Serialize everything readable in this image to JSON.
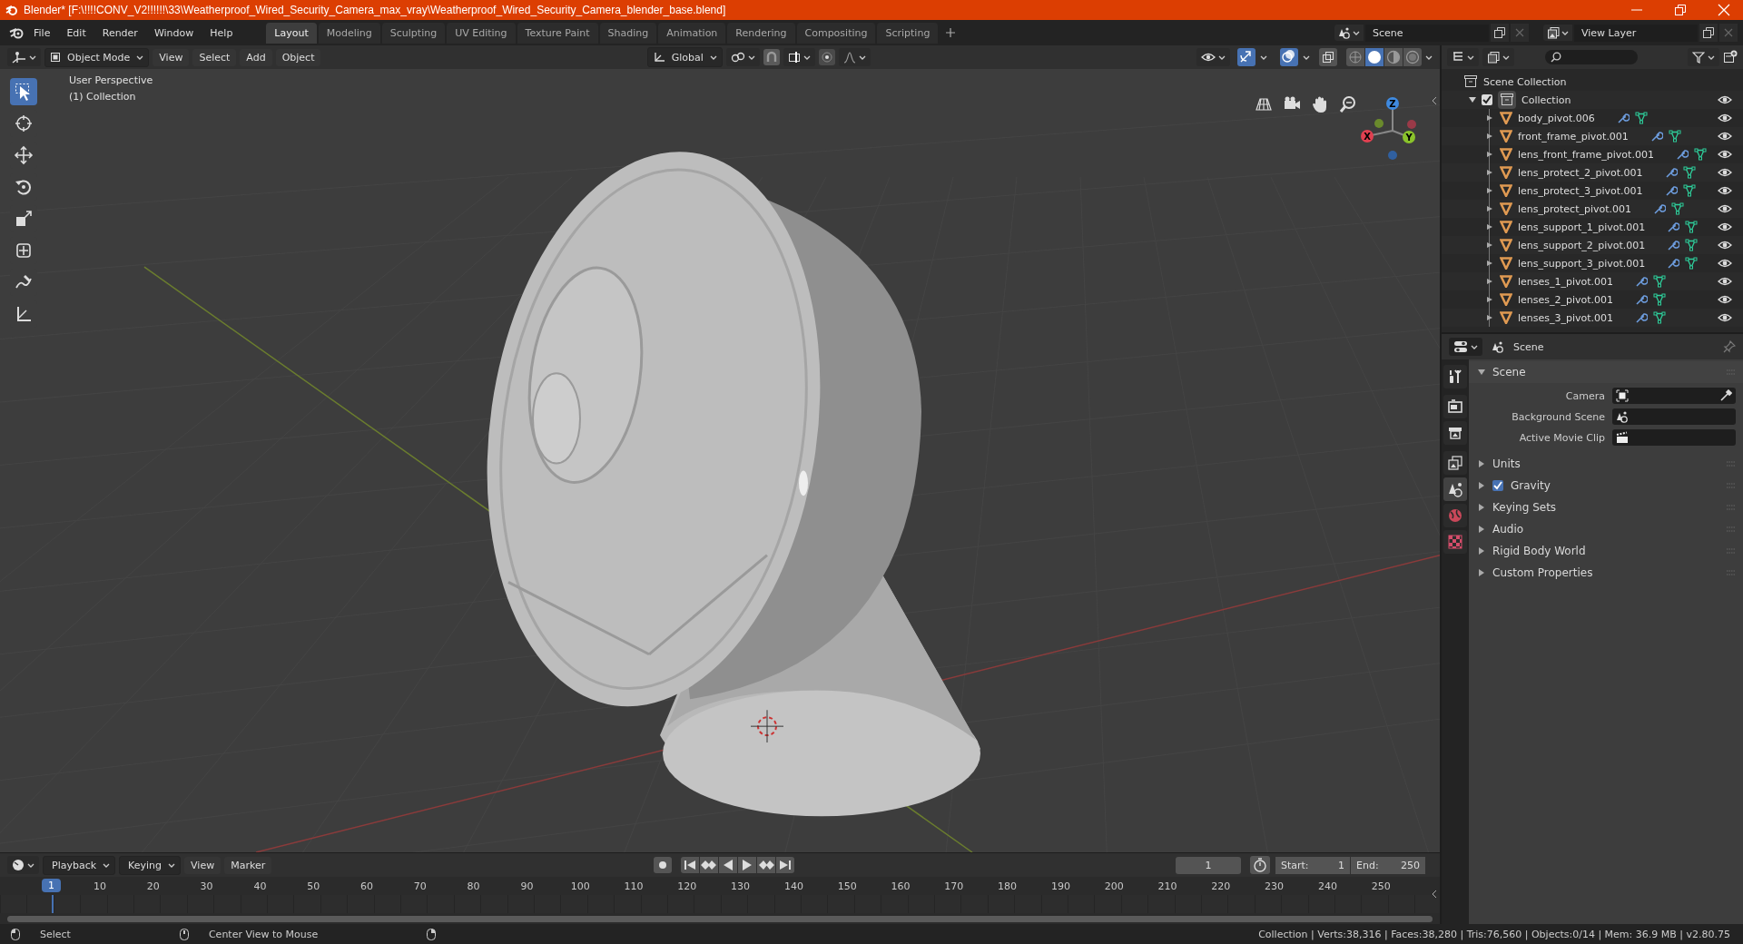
{
  "window": {
    "title": "Blender* [F:\\!!!!CONV_V2!!!!!!\\33\\Weatherproof_Wired_Security_Camera_max_vray\\Weatherproof_Wired_Security_Camera_blender_base.blend]"
  },
  "menu": [
    "File",
    "Edit",
    "Render",
    "Window",
    "Help"
  ],
  "workspaces": [
    {
      "label": "Layout",
      "selected": true
    },
    {
      "label": "Modeling",
      "selected": false
    },
    {
      "label": "Sculpting",
      "selected": false
    },
    {
      "label": "UV Editing",
      "selected": false
    },
    {
      "label": "Texture Paint",
      "selected": false
    },
    {
      "label": "Shading",
      "selected": false
    },
    {
      "label": "Animation",
      "selected": false
    },
    {
      "label": "Rendering",
      "selected": false
    },
    {
      "label": "Compositing",
      "selected": false
    },
    {
      "label": "Scripting",
      "selected": false
    }
  ],
  "scene": "Scene",
  "view_layer": "View Layer",
  "viewport": {
    "mode": "Object Mode",
    "menus": [
      "View",
      "Select",
      "Add",
      "Object"
    ],
    "orientation": "Global",
    "view_name": "User Perspective",
    "collection": "(1) Collection",
    "toggles": [
      {
        "kind": "gizmo",
        "on": true
      },
      {
        "kind": "overlay",
        "on": true
      }
    ],
    "shading": [
      {
        "kind": "wireframe",
        "selected": false
      },
      {
        "kind": "solid",
        "selected": true
      },
      {
        "kind": "material",
        "selected": false
      },
      {
        "kind": "rendered",
        "selected": false
      }
    ],
    "tools": [
      {
        "kind": "select",
        "selected": true
      },
      {
        "kind": "cursor",
        "selected": false
      },
      {
        "kind": "move",
        "selected": false
      },
      {
        "kind": "rotate",
        "selected": false
      },
      {
        "kind": "scale",
        "selected": false
      },
      {
        "kind": "transform",
        "selected": false
      },
      {
        "kind": "annotate",
        "selected": false
      },
      {
        "kind": "measure",
        "selected": false
      }
    ],
    "axes": [
      "X",
      "Y",
      "Z"
    ]
  },
  "outliner": {
    "root": "Scene Collection",
    "collections": [
      {
        "name": "Collection",
        "expanded": true,
        "checked": true,
        "children": [
          {
            "name": "body_pivot.006"
          },
          {
            "name": "front_frame_pivot.001"
          },
          {
            "name": "lens_front_frame_pivot.001"
          },
          {
            "name": "lens_protect_2_pivot.001"
          },
          {
            "name": "lens_protect_3_pivot.001"
          },
          {
            "name": "lens_protect_pivot.001"
          },
          {
            "name": "lens_support_1_pivot.001"
          },
          {
            "name": "lens_support_2_pivot.001"
          },
          {
            "name": "lens_support_3_pivot.001"
          },
          {
            "name": "lenses_1_pivot.001"
          },
          {
            "name": "lenses_2_pivot.001"
          },
          {
            "name": "lenses_3_pivot.001"
          }
        ]
      }
    ]
  },
  "properties": {
    "context": "Scene",
    "tabs": [
      {
        "kind": "tool",
        "selected": false
      },
      {
        "kind": "render",
        "selected": false
      },
      {
        "kind": "output",
        "selected": false
      },
      {
        "kind": "viewlayer",
        "selected": false
      },
      {
        "kind": "scene",
        "selected": true
      },
      {
        "kind": "world",
        "selected": false
      },
      {
        "kind": "texture",
        "selected": false
      }
    ],
    "panels": [
      {
        "kind": "panel",
        "label": "Scene",
        "expanded": true,
        "fields": [
          {
            "kind": "camera",
            "label": "Camera"
          },
          {
            "kind": "scene",
            "label": "Background Scene"
          },
          {
            "kind": "clip",
            "label": "Active Movie Clip"
          }
        ]
      },
      {
        "kind": "panel",
        "label": "Units",
        "expanded": false
      },
      {
        "kind": "toggle",
        "label": "Gravity",
        "expanded": false,
        "checked": true
      },
      {
        "kind": "panel",
        "label": "Keying Sets",
        "expanded": false
      },
      {
        "kind": "panel",
        "label": "Audio",
        "expanded": false
      },
      {
        "kind": "panel",
        "label": "Rigid Body World",
        "expanded": false
      },
      {
        "kind": "panel",
        "label": "Custom Properties",
        "expanded": false
      }
    ]
  },
  "timeline": {
    "menus": [
      {
        "label": "Playback",
        "dropdown": true
      },
      {
        "label": "Keying",
        "dropdown": true
      },
      {
        "label": "View",
        "dropdown": false
      },
      {
        "label": "Marker",
        "dropdown": false
      }
    ],
    "current_frame": "1",
    "start_label": "Start:",
    "start": "1",
    "end_label": "End:",
    "end": "250",
    "frame_marker": "1",
    "ruler": [
      "10",
      "20",
      "30",
      "40",
      "50",
      "60",
      "70",
      "80",
      "90",
      "100",
      "110",
      "120",
      "130",
      "140",
      "150",
      "160",
      "170",
      "180",
      "190",
      "200",
      "210",
      "220",
      "230",
      "240",
      "250"
    ]
  },
  "status_bar": {
    "hints": [
      "Select",
      "Center View to Mouse"
    ],
    "stats": "Collection | Verts:38,316 | Faces:38,280 | Tris:76,560 | Objects:0/14 | Mem: 36.9 MB | v2.80.75"
  }
}
